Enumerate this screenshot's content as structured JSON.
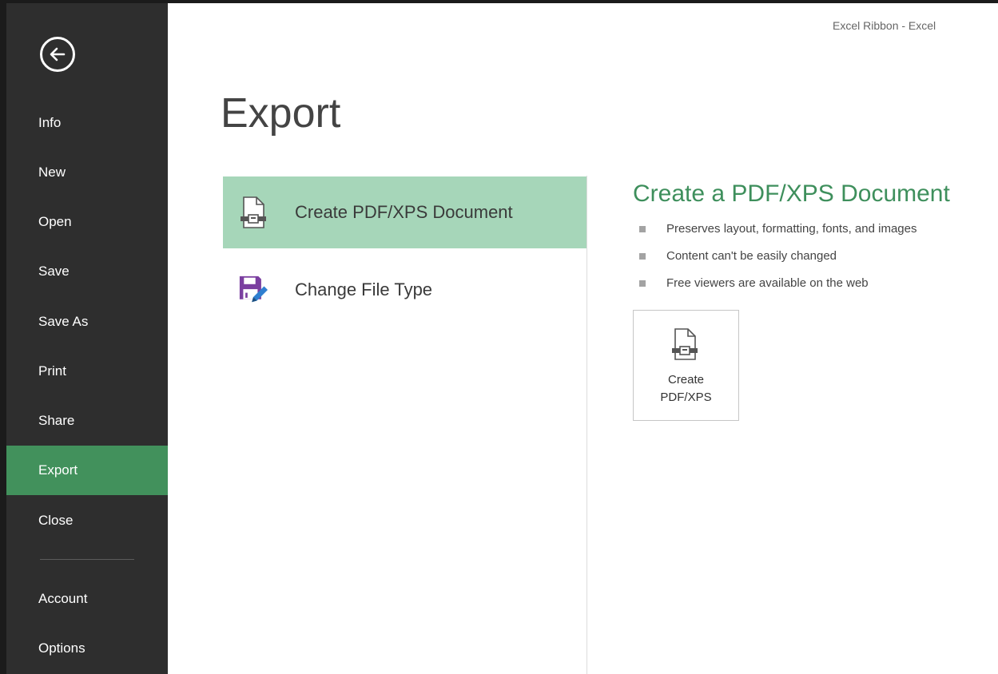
{
  "window": {
    "title": "Excel Ribbon - Excel"
  },
  "sidebar": {
    "back_icon": "back-arrow-circle-icon",
    "items": [
      {
        "label": "Info"
      },
      {
        "label": "New"
      },
      {
        "label": "Open"
      },
      {
        "label": "Save"
      },
      {
        "label": "Save As"
      },
      {
        "label": "Print"
      },
      {
        "label": "Share"
      },
      {
        "label": "Export",
        "active": true
      },
      {
        "label": "Close"
      },
      {
        "label": "Account"
      },
      {
        "label": "Options"
      }
    ]
  },
  "page": {
    "title": "Export"
  },
  "options": [
    {
      "label": "Create PDF/XPS Document",
      "icon": "pdf-document-icon",
      "selected": true
    },
    {
      "label": "Change File Type",
      "icon": "change-file-type-icon",
      "selected": false
    }
  ],
  "detail": {
    "title": "Create a PDF/XPS Document",
    "bullets": [
      "Preserves layout, formatting, fonts, and images",
      "Content can't be easily changed",
      "Free viewers are available on the web"
    ],
    "button": {
      "line1": "Create",
      "line2": "PDF/XPS",
      "icon": "pdf-document-icon"
    }
  },
  "colors": {
    "sidebar_bg": "#2e2e2e",
    "active_nav": "#42915c",
    "selected_option": "#a6d6b9",
    "accent_text": "#3e8f5c",
    "file_icon_purple": "#7b3fa0"
  }
}
